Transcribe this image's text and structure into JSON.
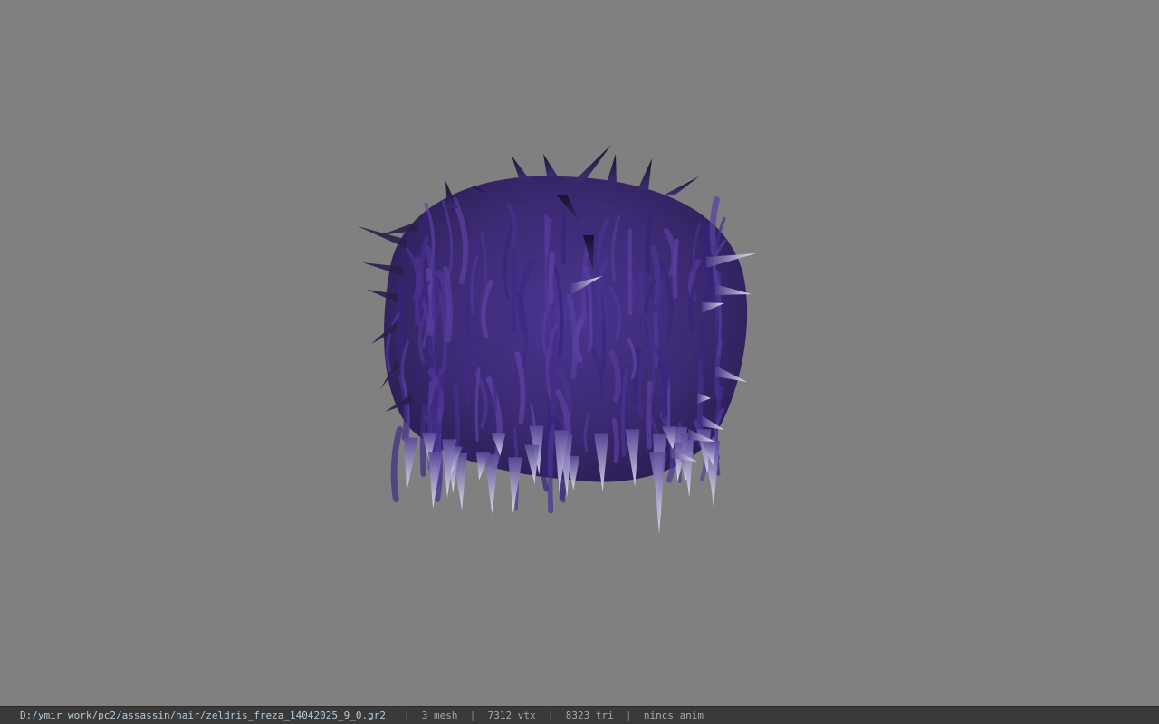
{
  "viewer": {
    "background_color": "#808080",
    "model": {
      "description_icon": "hair-model-icon",
      "hair_color": "#3c2a73",
      "tip_color": "#e6e6ec"
    }
  },
  "status_bar": {
    "file_path": "D:/ymir work/pc2/assassin/hair/zeldris_freza_14042025_9_0.gr2",
    "separator": "|",
    "mesh_count": "3 mesh",
    "vertex_count": "7312 vtx",
    "triangle_count": "8323 tri",
    "anim_info": "nincs anim"
  }
}
